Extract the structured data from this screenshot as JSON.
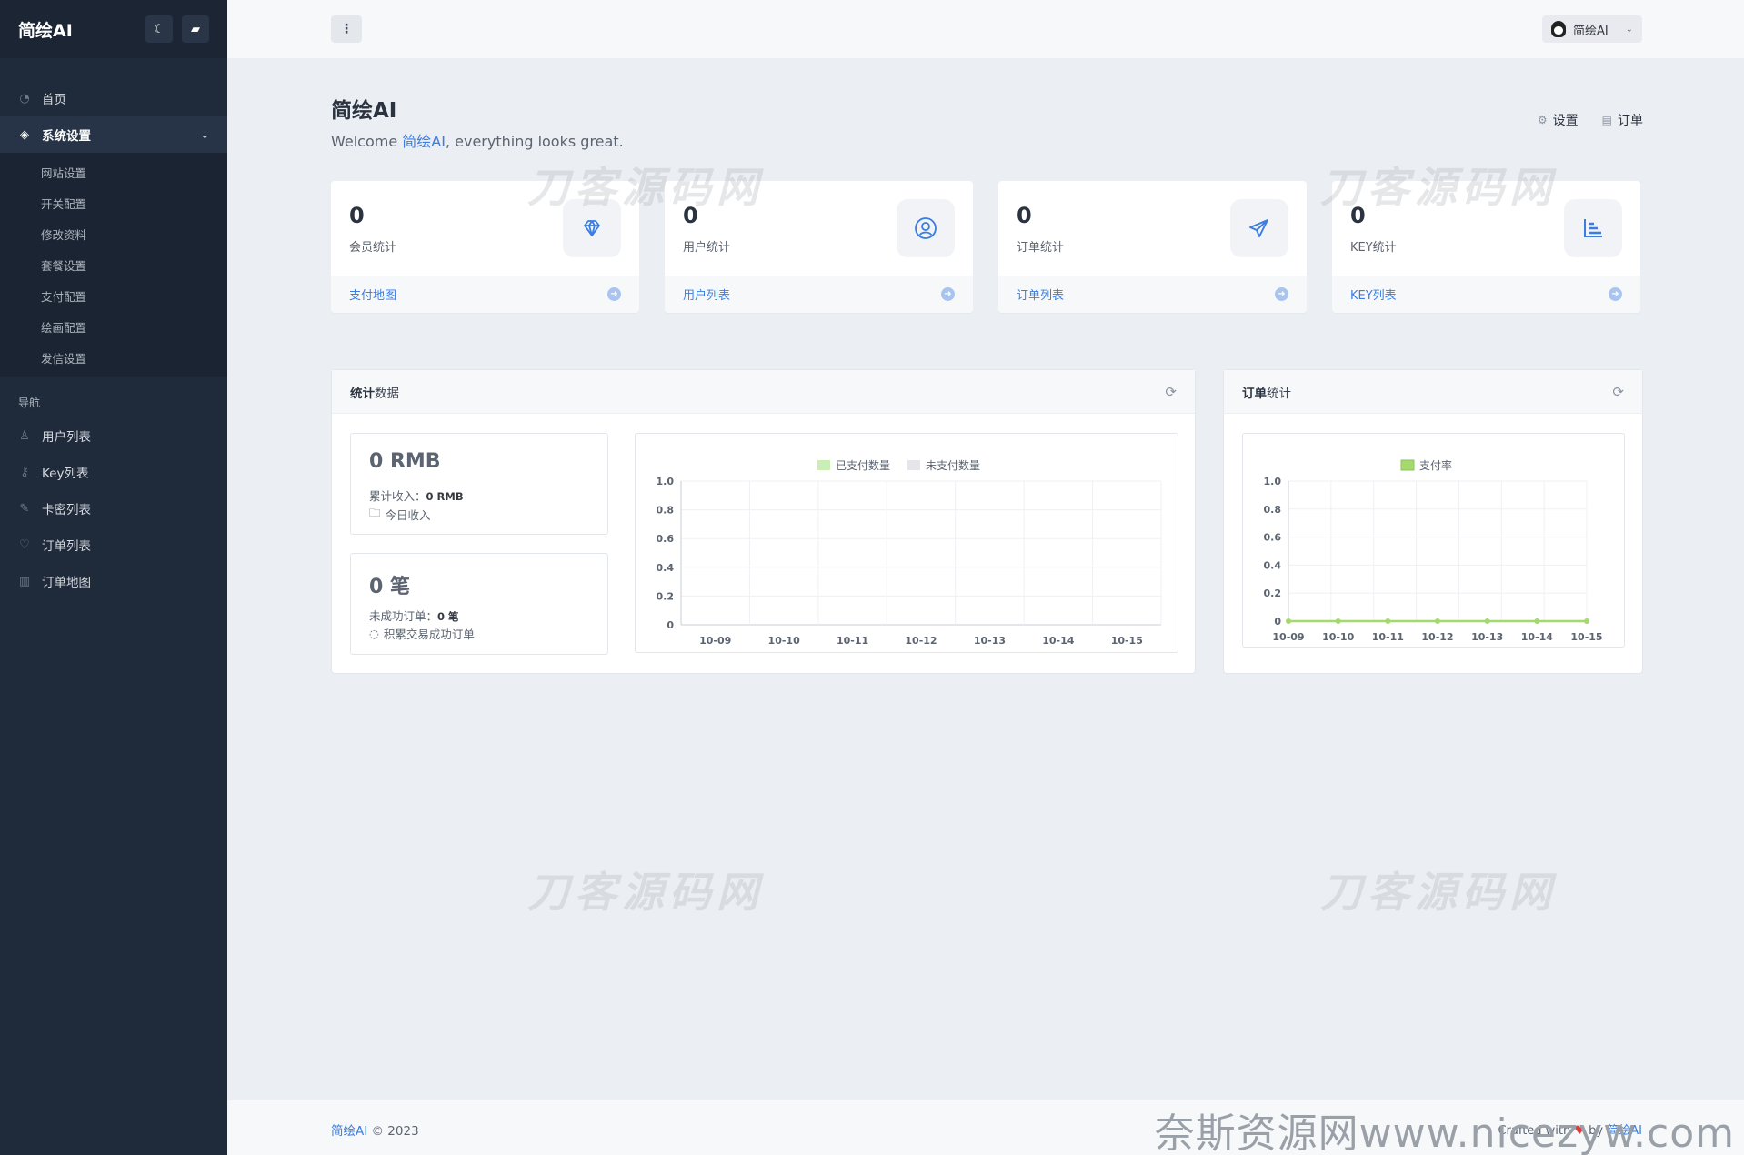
{
  "sidebar": {
    "brand": "简绘AI",
    "menu": [
      {
        "label": "首页",
        "icon": "dashboard-icon"
      },
      {
        "label": "系统设置",
        "icon": "layers-icon",
        "active": true
      }
    ],
    "submenu": [
      "网站设置",
      "开关配置",
      "修改资料",
      "套餐设置",
      "支付配置",
      "绘画配置",
      "发信设置"
    ],
    "nav_heading": "导航",
    "nav": [
      {
        "label": "用户列表",
        "icon": "user-icon"
      },
      {
        "label": "Key列表",
        "icon": "key-icon"
      },
      {
        "label": "卡密列表",
        "icon": "pen-icon"
      },
      {
        "label": "订单列表",
        "icon": "heart-icon"
      },
      {
        "label": "订单地图",
        "icon": "map-icon"
      }
    ]
  },
  "header": {
    "user": "简绘AI"
  },
  "page": {
    "title": "简绘AI",
    "welcome_pre": "Welcome ",
    "welcome_name": "简绘AI",
    "welcome_post": ", everything looks great.",
    "quick": [
      {
        "label": "设置",
        "icon": "gears-icon"
      },
      {
        "label": "订单",
        "icon": "chart-icon"
      }
    ]
  },
  "stats": [
    {
      "value": "0",
      "label": "会员统计",
      "link": "支付地图",
      "icon": "diamond-icon"
    },
    {
      "value": "0",
      "label": "用户统计",
      "link": "用户列表",
      "icon": "user-circle-icon"
    },
    {
      "value": "0",
      "label": "订单统计",
      "link": "订单列表",
      "icon": "paper-plane-icon"
    },
    {
      "value": "0",
      "label": "KEY统计",
      "link": "KEY列表",
      "icon": "bar-chart-icon"
    }
  ],
  "panel_stats": {
    "title_bold": "统计",
    "title_rest": "数据",
    "income": {
      "big": "0 RMB",
      "line1_label": "累计收入：",
      "line1_value": "0 RMB",
      "line2": "今日收入"
    },
    "orders": {
      "big": "0 笔",
      "line1_label": "未成功订单：",
      "line1_value": "0 笔",
      "line2": "积累交易成功订单"
    }
  },
  "panel_orders": {
    "title_bold": "订单",
    "title_rest": "统计"
  },
  "chart_data": [
    {
      "type": "line",
      "x": [
        "10-09",
        "10-10",
        "10-11",
        "10-12",
        "10-13",
        "10-14",
        "10-15"
      ],
      "series": [
        {
          "name": "已支付数量",
          "values": [
            0,
            0,
            0,
            0,
            0,
            0,
            0
          ],
          "color": "#c9efb6"
        },
        {
          "name": "未支付数量",
          "values": [
            0,
            0,
            0,
            0,
            0,
            0,
            0
          ],
          "color": "#e4e6ea"
        }
      ],
      "ylim": [
        0,
        1.0
      ],
      "yticks": [
        "0",
        "0.2",
        "0.4",
        "0.6",
        "0.8",
        "1.0"
      ],
      "legend": "top",
      "grid": true
    },
    {
      "type": "line",
      "x": [
        "10-09",
        "10-10",
        "10-11",
        "10-12",
        "10-13",
        "10-14",
        "10-15"
      ],
      "series": [
        {
          "name": "支付率",
          "values": [
            0,
            0,
            0,
            0,
            0,
            0,
            0
          ],
          "color": "#a5d86e"
        }
      ],
      "ylim": [
        0,
        1.0
      ],
      "yticks": [
        "0",
        "0.2",
        "0.4",
        "0.6",
        "0.8",
        "1.0"
      ],
      "legend": "top",
      "grid": true
    }
  ],
  "footer": {
    "brand": "简绘AI",
    "copy": " © 2023",
    "crafted_pre": "Crafted with ",
    "crafted_by": " by ",
    "crafted_name": "简绘AI",
    "banner": "奈斯资源网www.nicezyw.com"
  },
  "watermark": "刀客源码网"
}
